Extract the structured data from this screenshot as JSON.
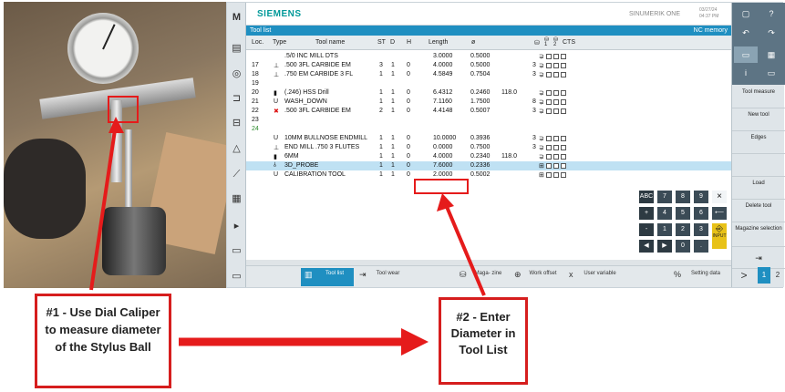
{
  "hmi": {
    "brand": "SIEMENS",
    "product": "SINUMERIK ONE",
    "datetime_line1": "03/27/24",
    "datetime_line2": "04:37 PM",
    "window_title": "Tool list",
    "window_right": "NC memory"
  },
  "table": {
    "columns": [
      "Loc.",
      "Type",
      "Tool name",
      "ST",
      "D",
      "H",
      "Length",
      "ø"
    ],
    "rows": [
      {
        "loc": "",
        "type": "",
        "name": ".5/0 INC MILL DTS",
        "st": "",
        "d": "",
        "h": "",
        "length": "3.0000",
        "dia": "0.5000",
        "extra": "",
        "p": "",
        "sel": false
      },
      {
        "loc": "17",
        "type": "tool",
        "name": ".500 3FL CARBIDE EM",
        "st": "3",
        "d": "1",
        "h": "0",
        "length": "4.0000",
        "dia": "0.5000",
        "extra": "",
        "p": "3",
        "sel": false
      },
      {
        "loc": "18",
        "type": "tool",
        "name": ".750 EM CARBIDE 3 FL",
        "st": "1",
        "d": "1",
        "h": "0",
        "length": "4.5849",
        "dia": "0.7504",
        "extra": "",
        "p": "3",
        "sel": false
      },
      {
        "loc": "19",
        "type": "",
        "name": "",
        "st": "",
        "d": "",
        "h": "",
        "length": "",
        "dia": "",
        "extra": "",
        "p": "",
        "sel": false
      },
      {
        "loc": "20",
        "type": "drill",
        "name": "(.246) HSS Drill",
        "st": "1",
        "d": "1",
        "h": "0",
        "length": "6.4312",
        "dia": "0.2460",
        "extra": "118.0",
        "p": "",
        "sel": false
      },
      {
        "loc": "21",
        "type": "u",
        "name": "WASH_DOWN",
        "st": "1",
        "d": "1",
        "h": "0",
        "length": "7.1160",
        "dia": "1.7500",
        "extra": "",
        "p": "8",
        "sel": false
      },
      {
        "loc": "22",
        "type": "x",
        "name": ".500 3FL CARBIDE EM",
        "st": "2",
        "d": "1",
        "h": "0",
        "length": "4.4148",
        "dia": "0.5007",
        "extra": "",
        "p": "3",
        "sel": false
      },
      {
        "loc": "23",
        "type": "",
        "name": "",
        "st": "",
        "d": "",
        "h": "",
        "length": "",
        "dia": "",
        "extra": "",
        "p": "",
        "sel": false
      },
      {
        "loc": "24",
        "type": "",
        "name": "",
        "st": "",
        "d": "",
        "h": "",
        "length": "",
        "dia": "",
        "extra": "",
        "p": "",
        "sel": false
      },
      {
        "loc": "",
        "type": "u",
        "name": "10MM BULLNOSE ENDMILL",
        "st": "1",
        "d": "1",
        "h": "0",
        "length": "10.0000",
        "dia": "0.3936",
        "extra": "",
        "p": "3",
        "sel": false
      },
      {
        "loc": "",
        "type": "tool",
        "name": "END MILL .750 3 FLUTES",
        "st": "1",
        "d": "1",
        "h": "0",
        "length": "0.0000",
        "dia": "0.7500",
        "extra": "",
        "p": "3",
        "sel": false
      },
      {
        "loc": "",
        "type": "drill",
        "name": "6MM",
        "st": "1",
        "d": "1",
        "h": "0",
        "length": "4.0000",
        "dia": "0.2340",
        "extra": "118.0",
        "p": "",
        "sel": false
      },
      {
        "loc": "",
        "type": "probe",
        "name": "3D_PROBE",
        "st": "1",
        "d": "1",
        "h": "0",
        "length": "7.6000",
        "dia": "0.2336",
        "extra": "",
        "p": "",
        "sel": true
      },
      {
        "loc": "",
        "type": "u",
        "name": "CALIBRATION TOOL",
        "st": "1",
        "d": "1",
        "h": "0",
        "length": "2.0000",
        "dia": "0.5002",
        "extra": "",
        "p": "",
        "sel": false
      }
    ]
  },
  "bottom_softkeys": [
    {
      "label": "Tool list",
      "active": true
    },
    {
      "label": "Tool wear",
      "active": false
    },
    {
      "label": "Maga- zine",
      "active": false
    },
    {
      "label": "Work offset",
      "active": false
    },
    {
      "label": "User variable",
      "active": false
    },
    {
      "label": "Setting data",
      "active": false
    }
  ],
  "right_softkeys": [
    "Tool measure",
    "New tool",
    "Edges",
    "Load",
    "Delete tool",
    "Magazine selection"
  ],
  "keypad": {
    "keys": [
      "ABC",
      "7",
      "8",
      "9",
      "+",
      "4",
      "5",
      "6",
      "-",
      "1",
      "2",
      "3",
      "0",
      "."
    ],
    "enter_label": "INPUT",
    "close": "×"
  },
  "pages": [
    "1",
    "2"
  ],
  "next_symbol": ">",
  "notes": {
    "note1": "#1 - Use      Dial Caliper to measure diameter of the Stylus Ball",
    "note2": "#2 - Enter Diameter in Tool List"
  },
  "colors": {
    "accent": "#1f8fc1",
    "brand": "#009999",
    "annotation_red": "#e51b1b",
    "selection": "#bfe1f3"
  }
}
